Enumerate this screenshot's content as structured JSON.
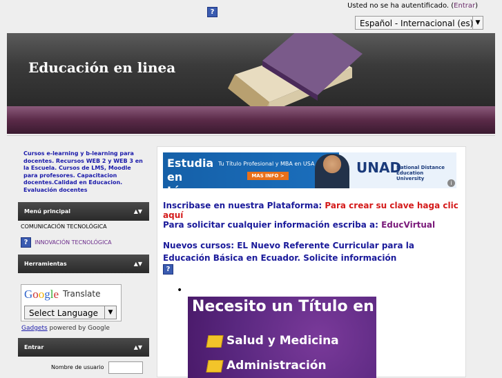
{
  "header": {
    "login_text": "Usted no se ha autentificado. (",
    "login_link": "Entrar",
    "login_close": ")",
    "language_selected": "Español - Internacional (es)",
    "help_icon": "?"
  },
  "banner": {
    "title": "Educación en linea"
  },
  "sidebar": {
    "promo": "Cursos e-learning y b-learning para docentes. Recursos WEB 2 y WEB 3 en la Escuela. Cursos de LMS, Moodle para profesores. Capacitacion docentes.Calidad en Educacion. Evaluación docentes",
    "menu_title": "Menú principal",
    "menu_item": "COMUNICACIÓN TECNOLÓGICA",
    "menu_link": "INNOVACIÓN TECNOLÓGICA",
    "tools_title": "Herramientas",
    "translate": {
      "logo": "Google",
      "word": "Translate",
      "select": "Select Language",
      "gadgets_link": "Gadgets",
      "gadgets_rest": " powered by Google"
    },
    "login_title": "Entrar",
    "username_label": "Nombre de usuario"
  },
  "content": {
    "ad": {
      "big": "Estudia en Línea",
      "sub": "Tu Título Profesional y MBA en USA",
      "button": "MAS INFO >",
      "brand": "UNAD",
      "university": "National Distance Education University",
      "info": "i"
    },
    "line1": "Inscribase en nuestra Plataforma: ",
    "line1_red": "Para crear su clave haga clic aquí",
    "line2": "Para solicitar cualquier información escriba a: ",
    "line2_purple": "EducVirtual",
    "line3": "Nuevos cursos: EL Nuevo Referente Curricular para la Educación Básica en Ecuador. Solicite información",
    "bullet": "•",
    "purple_ad": {
      "title": "Necesito un Título en",
      "item1": "Salud y Medicina",
      "item2": "Administración"
    }
  },
  "colors": {
    "accent_blue": "#1a1a9a",
    "accent_red": "#d41a1a",
    "banner_dark": "#3a3a3a"
  }
}
